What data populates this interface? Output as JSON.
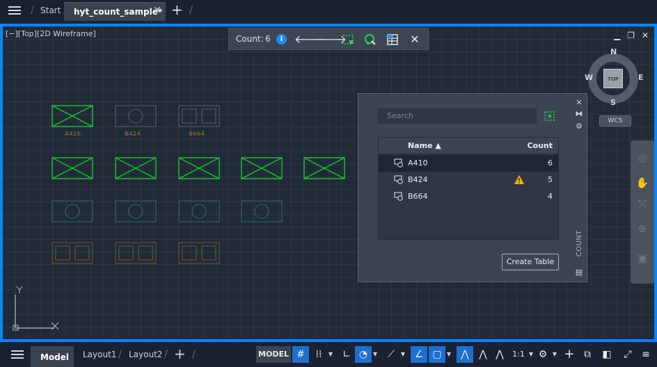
{
  "titlebar": {
    "tab_start": "Start",
    "tab_active": "hyt_count_sample*",
    "close_glyph": "✕",
    "new_tab_glyph": "+"
  },
  "viewport": {
    "label": "[−][Top][2D Wireframe]"
  },
  "count_toolbar": {
    "label": "Count:",
    "value": "6"
  },
  "viewcube": {
    "top_label": "TOP",
    "north": "N",
    "south": "S",
    "east": "E",
    "west": "W",
    "wcs": "WCS"
  },
  "blocks": {
    "label_a": "A410",
    "label_b": "B424",
    "label_c": "B664"
  },
  "count_palette": {
    "search_placeholder": "Search",
    "col_name": "Name",
    "col_count": "Count",
    "rows": [
      {
        "name": "A410",
        "count": "6",
        "warning": false
      },
      {
        "name": "B424",
        "count": "5",
        "warning": true
      },
      {
        "name": "B664",
        "count": "4",
        "warning": false
      }
    ],
    "create_table": "Create Table",
    "side_title": "COUNT"
  },
  "statusbar": {
    "tab_model": "Model",
    "tab_layout1": "Layout1",
    "tab_layout2": "Layout2",
    "model_button": "MODEL",
    "scale": "1:1"
  },
  "colors": {
    "accent": "#0a84ff",
    "block_highlight": "#18c12f",
    "block_dim_teal": "#2f6b72",
    "block_dim_brown": "#6c5a36"
  }
}
